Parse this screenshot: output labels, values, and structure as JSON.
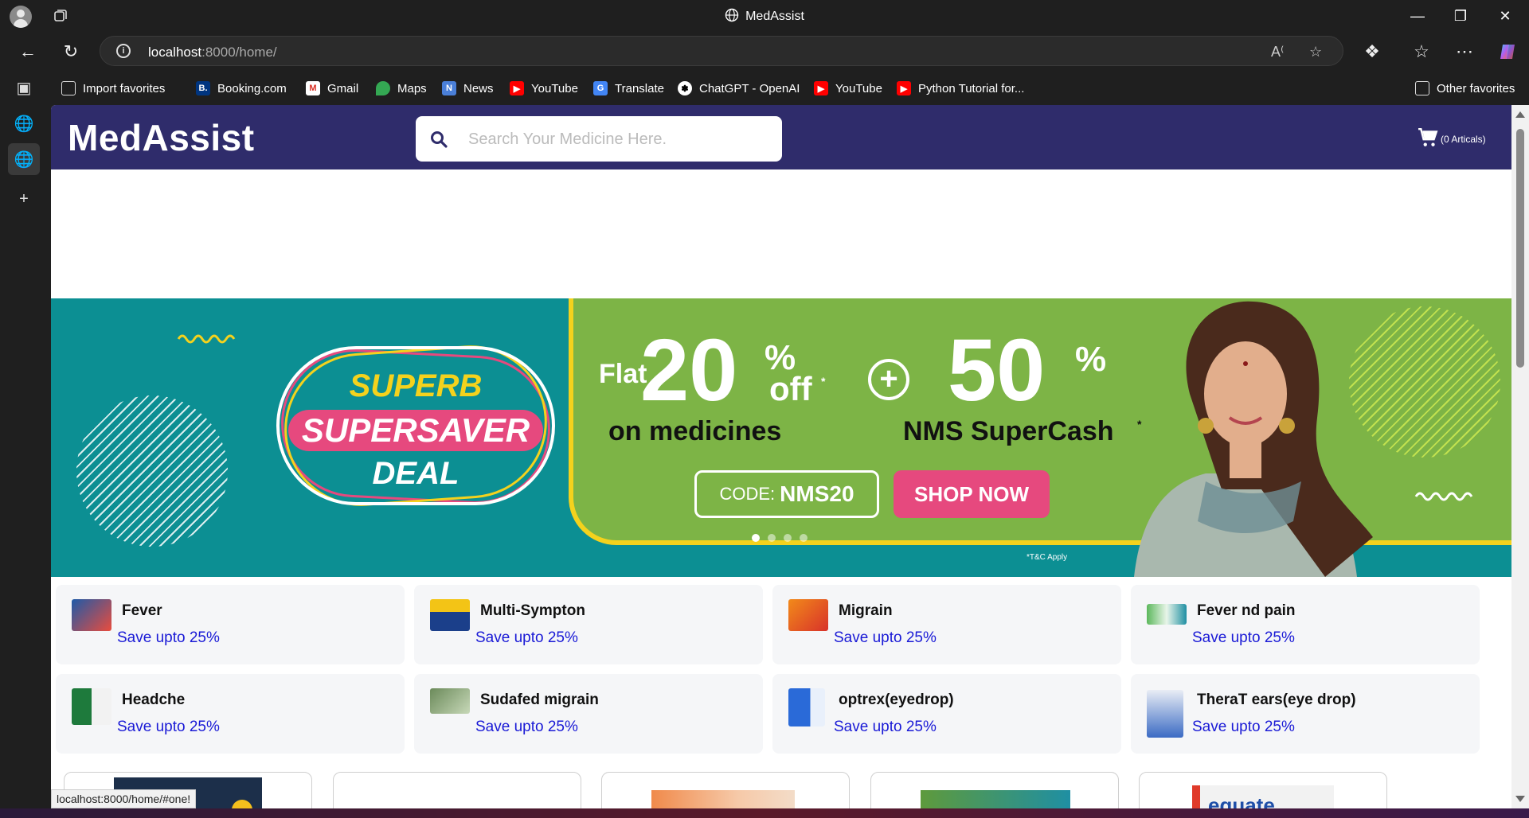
{
  "browser": {
    "window_title": "MedAssist",
    "url_host": "localhost",
    "url_rest": ":8000/home/",
    "favorites": [
      {
        "label": "Import favorites",
        "icon": "import-icon"
      },
      {
        "label": "Booking.com",
        "icon": "booking-icon"
      },
      {
        "label": "Gmail",
        "icon": "gmail-icon"
      },
      {
        "label": "Maps",
        "icon": "maps-icon"
      },
      {
        "label": "News",
        "icon": "news-icon"
      },
      {
        "label": "YouTube",
        "icon": "youtube-icon"
      },
      {
        "label": "Translate",
        "icon": "translate-icon"
      },
      {
        "label": "ChatGPT - OpenAI",
        "icon": "chatgpt-icon"
      },
      {
        "label": "YouTube",
        "icon": "youtube-icon"
      },
      {
        "label": "Python Tutorial for...",
        "icon": "youtube-icon"
      }
    ],
    "other_favorites": "Other favorites",
    "status_url": "localhost:8000/home/#one!"
  },
  "site": {
    "logo": "MedAssist",
    "search_placeholder": "Search Your Medicine Here.",
    "cart_label": "(0 Articals)",
    "header_color": "#2f2c6b"
  },
  "banner": {
    "deal_line1": "SUPERB",
    "deal_line2": "SUPERSAVER",
    "deal_line3": "DEAL",
    "flat": "Flat",
    "pct1": "20",
    "pct_sign1": "%",
    "off": "off",
    "asterisk1": "*",
    "on_medicines": "on medicines",
    "pct2": "50",
    "pct_sign2": "%",
    "supercash": "NMS SuperCash",
    "asterisk2": "*",
    "code_label": "CODE:",
    "code_value": "NMS20",
    "shop_now": "SHOP NOW",
    "tc": "*T&C Apply",
    "slide_count": 4,
    "active_slide": 1
  },
  "categories": [
    {
      "name": "Fever",
      "save": "Save upto 25%"
    },
    {
      "name": "Multi-Sympton",
      "save": "Save upto 25%"
    },
    {
      "name": "Migrain",
      "save": "Save upto 25%"
    },
    {
      "name": "Fever nd pain",
      "save": "Save upto 25%"
    },
    {
      "name": "Headche",
      "save": "Save upto 25%"
    },
    {
      "name": "Sudafed migrain",
      "save": "Save upto 25%"
    },
    {
      "name": "optrex(eyedrop)",
      "save": "Save upto 25%"
    },
    {
      "name": "TheraT ears(eye drop)",
      "save": "Save upto 25%"
    }
  ],
  "products_peek": {
    "equate_text": "equate"
  }
}
